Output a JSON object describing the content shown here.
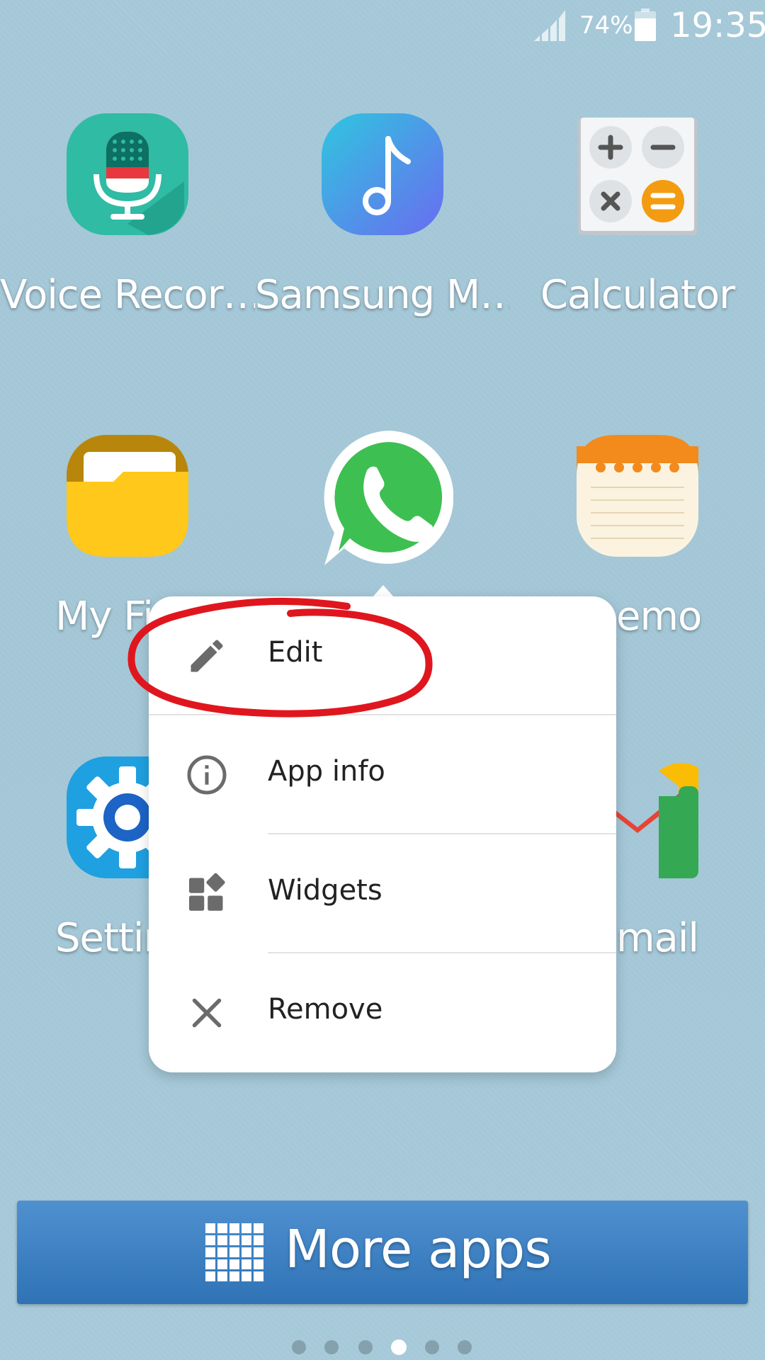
{
  "status_bar": {
    "battery_percent": "74%",
    "time": "19:35",
    "icons": [
      "signal-icon",
      "battery-icon"
    ]
  },
  "apps": [
    {
      "label": "Voice Recor…",
      "icon": "microphone-icon"
    },
    {
      "label": "Samsung M…",
      "icon": "music-note-icon"
    },
    {
      "label": "Calculator",
      "icon": "calculator-icon"
    },
    {
      "label": "My Fi",
      "icon": "folder-icon"
    },
    {
      "label": "",
      "icon": "whatsapp-icon"
    },
    {
      "label": "emo",
      "icon": "notepad-icon"
    },
    {
      "label": "Settir",
      "icon": "gear-icon"
    },
    {
      "label": "mail",
      "icon": "gmail-icon"
    }
  ],
  "popup_menu": {
    "items": [
      {
        "label": "Edit",
        "icon": "pencil-icon"
      },
      {
        "label": "App info",
        "icon": "info-icon"
      },
      {
        "label": "Widgets",
        "icon": "widgets-icon"
      },
      {
        "label": "Remove",
        "icon": "close-icon"
      }
    ],
    "highlight_color": "#e0161e"
  },
  "more_apps": {
    "label": "More apps",
    "icon": "app-grid-icon"
  },
  "page_indicator": {
    "pages": 6,
    "current_page": 4
  }
}
